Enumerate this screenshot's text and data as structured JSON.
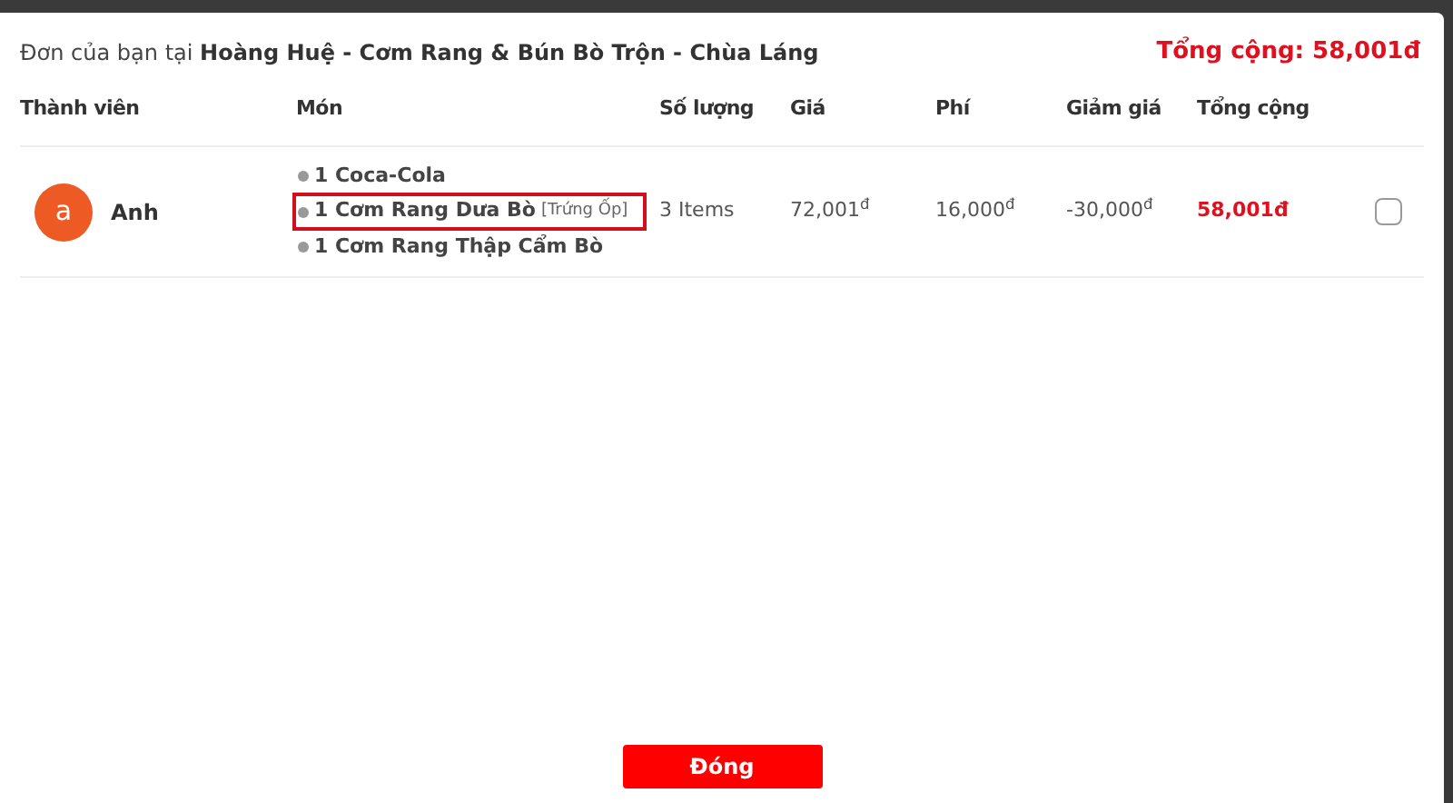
{
  "dialog": {
    "title_prefix": "Đơn của bạn tại",
    "restaurant": "Hoàng Huệ - Cơm Rang & Bún Bò Trộn - Chùa Láng",
    "grand_total": "Tổng cộng: 58,001đ"
  },
  "table": {
    "columns": [
      "Thành viên",
      "Món",
      "Số lượng",
      "Giá",
      "Phí",
      "Giảm giá",
      "Tổng cộng"
    ],
    "rows": [
      {
        "avatar": "a",
        "member": "Anh",
        "items": [
          {
            "text": "1 Coca-Cola",
            "highlighted": false
          },
          {
            "text": "1 Cơm Rang Dưa Bò",
            "note": "[Trứng Ốp]",
            "highlighted": true
          },
          {
            "text": "1 Cơm Rang Thập Cẩm Bò",
            "highlighted": false
          }
        ],
        "quantity": "3 Items",
        "price": "72,001$^{đ}$",
        "fee": "16,000$^{đ}$",
        "discount": "-30,000$^{đ}$",
        "total": "58,001đ",
        "checked": false
      }
    ]
  },
  "close_button": "Đóng"
}
